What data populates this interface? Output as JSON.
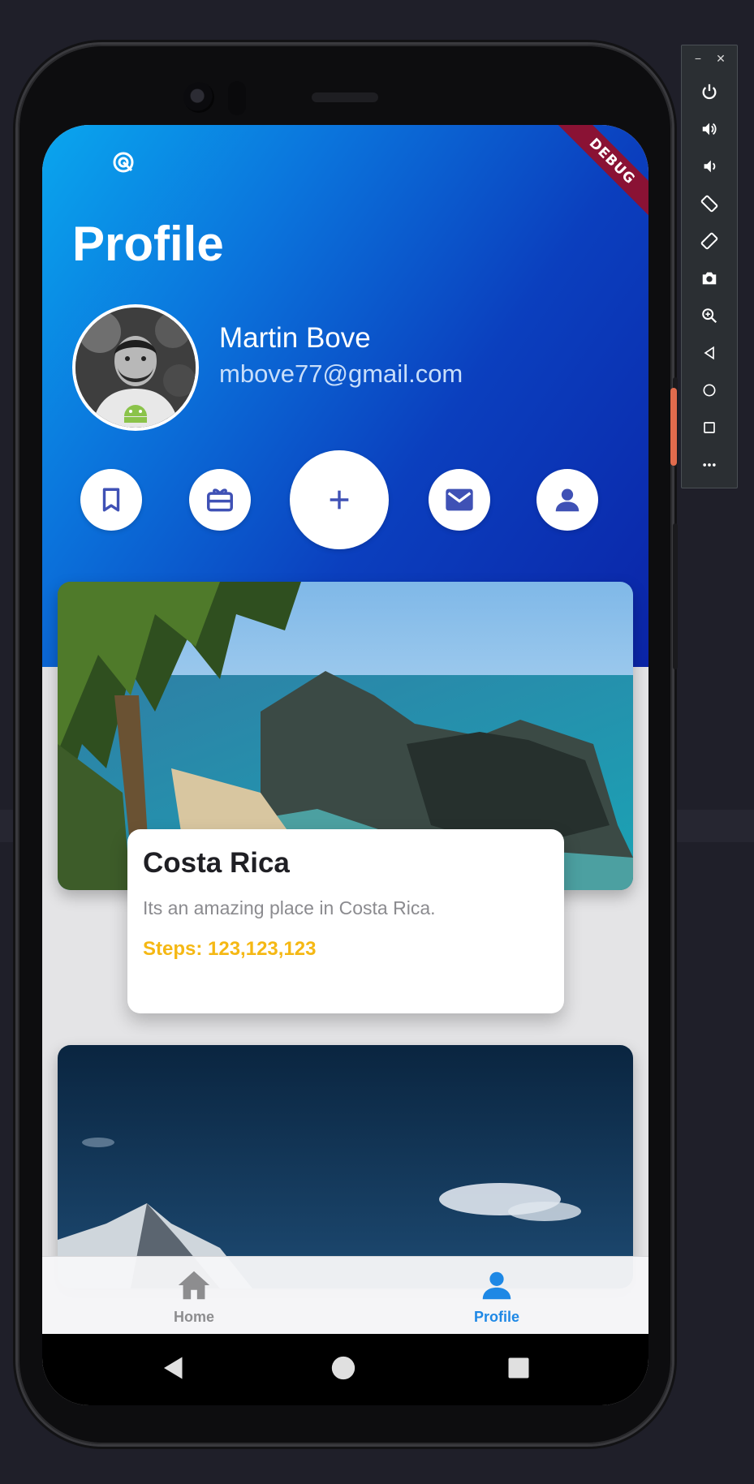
{
  "status_bar": {
    "icon": "radar-icon"
  },
  "debug_banner": "DEBUG",
  "profile": {
    "title": "Profile",
    "name": "Martin Bove",
    "email": "mbove77@gmail.com",
    "avatar_icon": "android-icon"
  },
  "actions": [
    {
      "icon": "bookmark-icon"
    },
    {
      "icon": "card-giftcard-icon"
    },
    {
      "icon": "add-icon"
    },
    {
      "icon": "mail-icon"
    },
    {
      "icon": "person-icon"
    }
  ],
  "places": [
    {
      "title": "Costa Rica",
      "description": "Its an amazing place in Costa Rica.",
      "steps": "Steps: 123,123,123"
    }
  ],
  "bottom_nav": {
    "items": [
      {
        "label": "Home",
        "icon": "home-icon",
        "active": false
      },
      {
        "label": "Profile",
        "icon": "person-icon",
        "active": true
      }
    ],
    "active_color": "#1e88e5",
    "inactive_color": "#8d8d8f"
  },
  "colors": {
    "header_gradient_start": "#0aa6ee",
    "header_gradient_end": "#0b25a8",
    "accent_icon": "#3f51b5",
    "steps_color": "#f5b814",
    "debug_banner": "#8a1234"
  },
  "emulator_toolbar": {
    "top_controls": [
      "minimize-icon",
      "close-icon"
    ],
    "buttons": [
      "power-icon",
      "volume-up-icon",
      "volume-down-icon",
      "rotate-left-icon",
      "rotate-right-icon",
      "camera-icon",
      "zoom-icon",
      "back-icon",
      "home-icon",
      "overview-icon",
      "more-icon"
    ]
  }
}
